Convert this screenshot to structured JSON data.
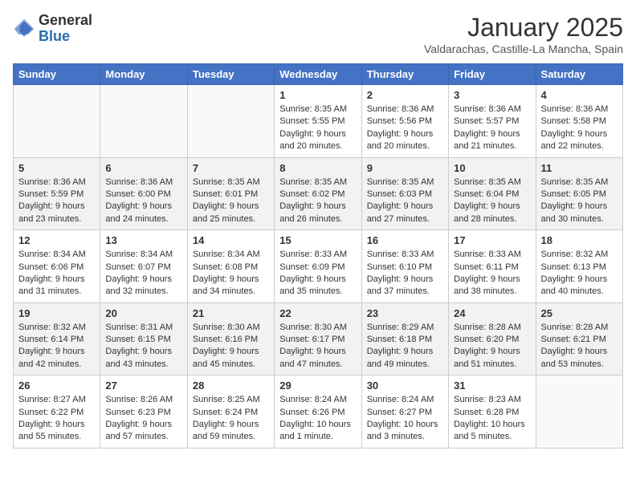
{
  "header": {
    "logo_general": "General",
    "logo_blue": "Blue",
    "month_title": "January 2025",
    "subtitle": "Valdarachas, Castille-La Mancha, Spain"
  },
  "calendar": {
    "days_of_week": [
      "Sunday",
      "Monday",
      "Tuesday",
      "Wednesday",
      "Thursday",
      "Friday",
      "Saturday"
    ],
    "weeks": [
      [
        {
          "day": "",
          "info": ""
        },
        {
          "day": "",
          "info": ""
        },
        {
          "day": "",
          "info": ""
        },
        {
          "day": "1",
          "info": "Sunrise: 8:35 AM\nSunset: 5:55 PM\nDaylight: 9 hours\nand 20 minutes."
        },
        {
          "day": "2",
          "info": "Sunrise: 8:36 AM\nSunset: 5:56 PM\nDaylight: 9 hours\nand 20 minutes."
        },
        {
          "day": "3",
          "info": "Sunrise: 8:36 AM\nSunset: 5:57 PM\nDaylight: 9 hours\nand 21 minutes."
        },
        {
          "day": "4",
          "info": "Sunrise: 8:36 AM\nSunset: 5:58 PM\nDaylight: 9 hours\nand 22 minutes."
        }
      ],
      [
        {
          "day": "5",
          "info": "Sunrise: 8:36 AM\nSunset: 5:59 PM\nDaylight: 9 hours\nand 23 minutes."
        },
        {
          "day": "6",
          "info": "Sunrise: 8:36 AM\nSunset: 6:00 PM\nDaylight: 9 hours\nand 24 minutes."
        },
        {
          "day": "7",
          "info": "Sunrise: 8:35 AM\nSunset: 6:01 PM\nDaylight: 9 hours\nand 25 minutes."
        },
        {
          "day": "8",
          "info": "Sunrise: 8:35 AM\nSunset: 6:02 PM\nDaylight: 9 hours\nand 26 minutes."
        },
        {
          "day": "9",
          "info": "Sunrise: 8:35 AM\nSunset: 6:03 PM\nDaylight: 9 hours\nand 27 minutes."
        },
        {
          "day": "10",
          "info": "Sunrise: 8:35 AM\nSunset: 6:04 PM\nDaylight: 9 hours\nand 28 minutes."
        },
        {
          "day": "11",
          "info": "Sunrise: 8:35 AM\nSunset: 6:05 PM\nDaylight: 9 hours\nand 30 minutes."
        }
      ],
      [
        {
          "day": "12",
          "info": "Sunrise: 8:34 AM\nSunset: 6:06 PM\nDaylight: 9 hours\nand 31 minutes."
        },
        {
          "day": "13",
          "info": "Sunrise: 8:34 AM\nSunset: 6:07 PM\nDaylight: 9 hours\nand 32 minutes."
        },
        {
          "day": "14",
          "info": "Sunrise: 8:34 AM\nSunset: 6:08 PM\nDaylight: 9 hours\nand 34 minutes."
        },
        {
          "day": "15",
          "info": "Sunrise: 8:33 AM\nSunset: 6:09 PM\nDaylight: 9 hours\nand 35 minutes."
        },
        {
          "day": "16",
          "info": "Sunrise: 8:33 AM\nSunset: 6:10 PM\nDaylight: 9 hours\nand 37 minutes."
        },
        {
          "day": "17",
          "info": "Sunrise: 8:33 AM\nSunset: 6:11 PM\nDaylight: 9 hours\nand 38 minutes."
        },
        {
          "day": "18",
          "info": "Sunrise: 8:32 AM\nSunset: 6:13 PM\nDaylight: 9 hours\nand 40 minutes."
        }
      ],
      [
        {
          "day": "19",
          "info": "Sunrise: 8:32 AM\nSunset: 6:14 PM\nDaylight: 9 hours\nand 42 minutes."
        },
        {
          "day": "20",
          "info": "Sunrise: 8:31 AM\nSunset: 6:15 PM\nDaylight: 9 hours\nand 43 minutes."
        },
        {
          "day": "21",
          "info": "Sunrise: 8:30 AM\nSunset: 6:16 PM\nDaylight: 9 hours\nand 45 minutes."
        },
        {
          "day": "22",
          "info": "Sunrise: 8:30 AM\nSunset: 6:17 PM\nDaylight: 9 hours\nand 47 minutes."
        },
        {
          "day": "23",
          "info": "Sunrise: 8:29 AM\nSunset: 6:18 PM\nDaylight: 9 hours\nand 49 minutes."
        },
        {
          "day": "24",
          "info": "Sunrise: 8:28 AM\nSunset: 6:20 PM\nDaylight: 9 hours\nand 51 minutes."
        },
        {
          "day": "25",
          "info": "Sunrise: 8:28 AM\nSunset: 6:21 PM\nDaylight: 9 hours\nand 53 minutes."
        }
      ],
      [
        {
          "day": "26",
          "info": "Sunrise: 8:27 AM\nSunset: 6:22 PM\nDaylight: 9 hours\nand 55 minutes."
        },
        {
          "day": "27",
          "info": "Sunrise: 8:26 AM\nSunset: 6:23 PM\nDaylight: 9 hours\nand 57 minutes."
        },
        {
          "day": "28",
          "info": "Sunrise: 8:25 AM\nSunset: 6:24 PM\nDaylight: 9 hours\nand 59 minutes."
        },
        {
          "day": "29",
          "info": "Sunrise: 8:24 AM\nSunset: 6:26 PM\nDaylight: 10 hours\nand 1 minute."
        },
        {
          "day": "30",
          "info": "Sunrise: 8:24 AM\nSunset: 6:27 PM\nDaylight: 10 hours\nand 3 minutes."
        },
        {
          "day": "31",
          "info": "Sunrise: 8:23 AM\nSunset: 6:28 PM\nDaylight: 10 hours\nand 5 minutes."
        },
        {
          "day": "",
          "info": ""
        }
      ]
    ]
  }
}
